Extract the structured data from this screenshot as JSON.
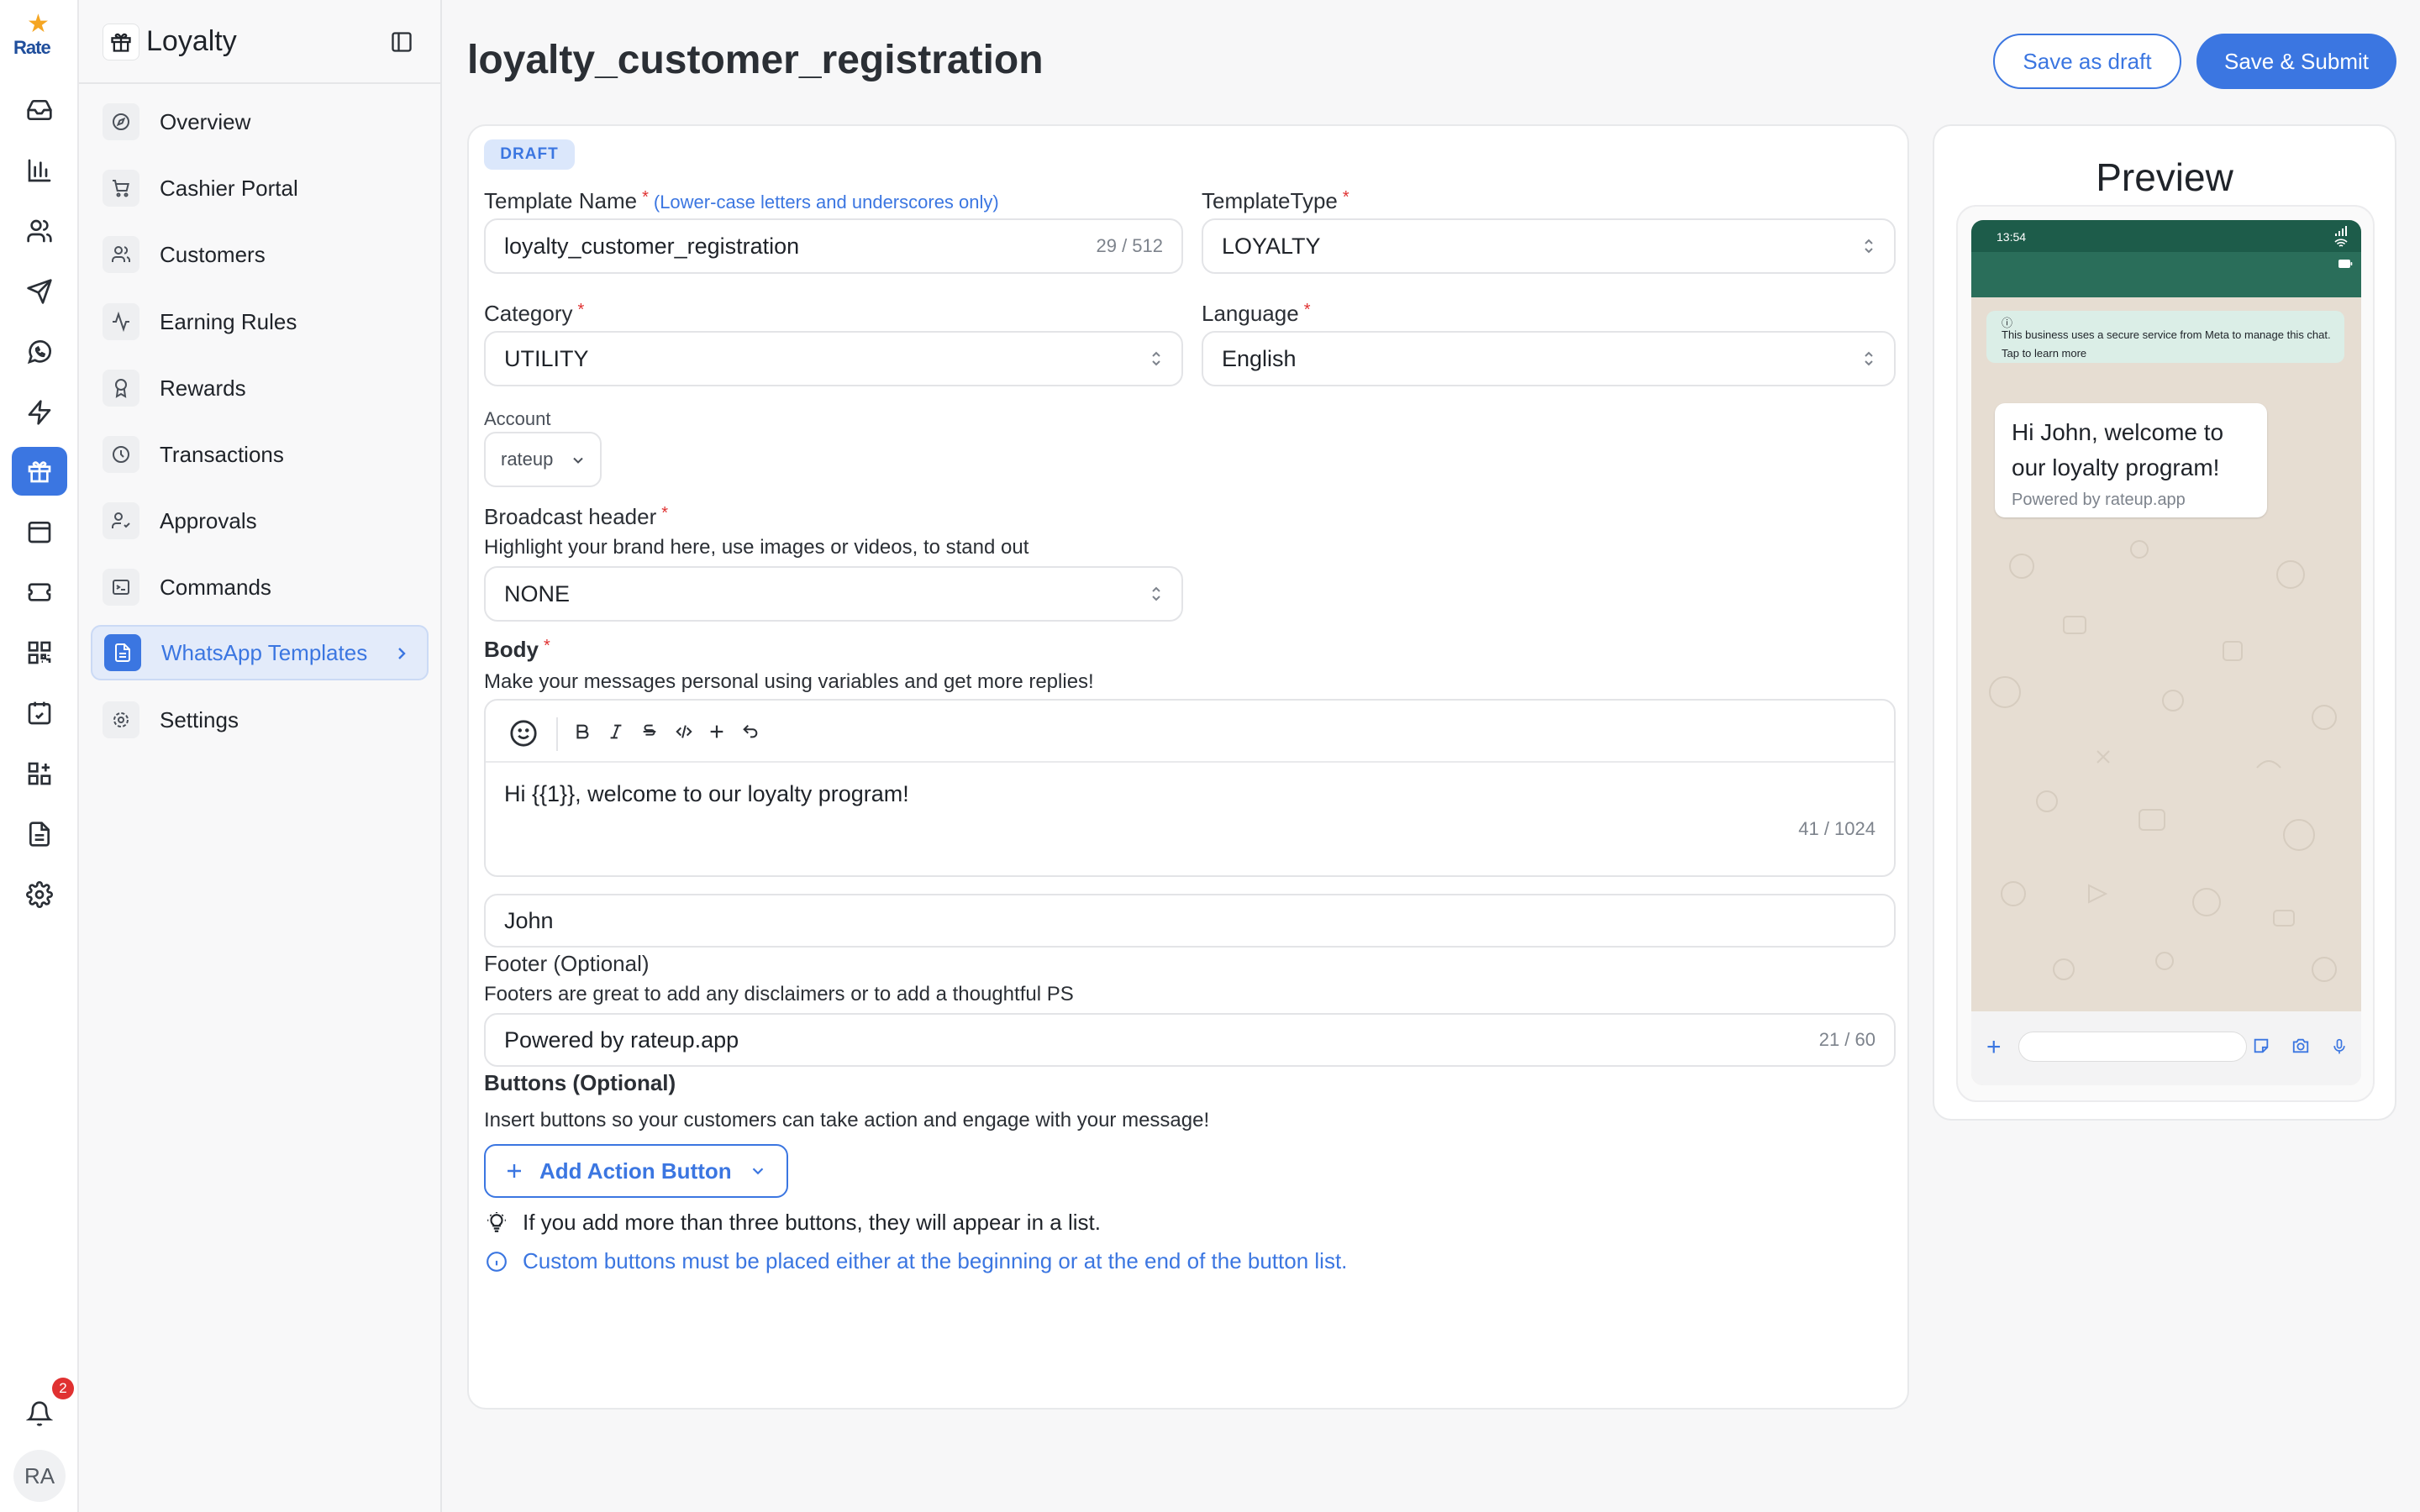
{
  "app": {
    "logo_text": "Rate",
    "section_title": "Loyalty",
    "notifications_count": "2",
    "avatar_initials": "RA"
  },
  "rail": {
    "icons": [
      "inbox-icon",
      "chart-icon",
      "users-icon",
      "send-icon",
      "whatsapp-icon",
      "bolt-icon",
      "gift-icon",
      "calendar-icon",
      "ticket-icon",
      "qr-icon",
      "calendar-check-icon",
      "apps-icon",
      "document-icon",
      "gear-icon"
    ],
    "active_index": 6
  },
  "sidebar": {
    "items": [
      {
        "label": "Overview",
        "icon": "compass-icon"
      },
      {
        "label": "Cashier Portal",
        "icon": "cart-icon"
      },
      {
        "label": "Customers",
        "icon": "users-icon"
      },
      {
        "label": "Earning Rules",
        "icon": "activity-icon"
      },
      {
        "label": "Rewards",
        "icon": "award-icon"
      },
      {
        "label": "Transactions",
        "icon": "clock-icon"
      },
      {
        "label": "Approvals",
        "icon": "user-check-icon"
      },
      {
        "label": "Commands",
        "icon": "terminal-icon"
      },
      {
        "label": "WhatsApp Templates",
        "icon": "document-icon",
        "active": true
      },
      {
        "label": "Settings",
        "icon": "gear-icon"
      }
    ]
  },
  "header": {
    "title": "loyalty_customer_registration",
    "save_draft_label": "Save as draft",
    "save_submit_label": "Save & Submit"
  },
  "form": {
    "status_badge": "DRAFT",
    "template_name": {
      "label": "Template Name",
      "hint": "(Lower-case letters and underscores only)",
      "value": "loyalty_customer_registration",
      "count": "29 / 512"
    },
    "template_type": {
      "label": "TemplateType",
      "value": "LOYALTY"
    },
    "category": {
      "label": "Category",
      "value": "UTILITY"
    },
    "language": {
      "label": "Language",
      "value": "English"
    },
    "account": {
      "label": "Account",
      "value": "rateup"
    },
    "broadcast_header": {
      "label": "Broadcast header",
      "description": "Highlight your brand here, use images or videos, to stand out",
      "value": "NONE"
    },
    "body": {
      "label": "Body",
      "description": "Make your messages personal using variables and get more replies!",
      "text": "Hi {{1}}, welcome to our loyalty program!",
      "count": "41 / 1024",
      "variable_value": "John"
    },
    "footer": {
      "label": "Footer (Optional)",
      "description": "Footers are great to add any disclaimers or to add a thoughtful PS",
      "value": "Powered by rateup.app",
      "count": "21 / 60"
    },
    "buttons": {
      "label": "Buttons (Optional)",
      "description": "Insert buttons so your customers can take action and engage with your message!",
      "add_label": "Add Action Button",
      "tip": "If you add more than three buttons, they will appear in a list.",
      "info": "Custom buttons must be placed either at the beginning or at the end of the button list."
    }
  },
  "preview": {
    "title": "Preview",
    "time": "13:54",
    "system_message": "This business uses a secure service from Meta to manage this chat. Tap to learn more",
    "bubble_text": "Hi John, welcome to our loyalty program!",
    "bubble_footer": "Powered by rateup.app"
  },
  "colors": {
    "accent": "#3b76e1",
    "required": "#e03131",
    "whatsapp_header": "#1d5c4a"
  }
}
